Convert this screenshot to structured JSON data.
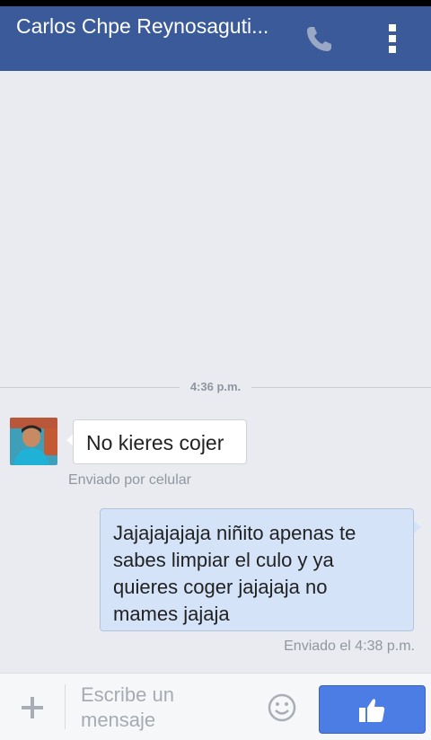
{
  "header": {
    "title": "Carlos Chpe Reynosaguti...",
    "call_icon": "phone-icon",
    "menu_icon": "overflow-menu-icon"
  },
  "conversation": {
    "time_separator": "4:36 p.m.",
    "messages": [
      {
        "direction": "incoming",
        "text": "No kieres cojer",
        "meta": "Enviado por celular",
        "avatar": "contact-avatar"
      },
      {
        "direction": "outgoing",
        "lines": [
          "Jajajajajaja niñito apenas te",
          "sabes limpiar el culo y ya",
          "quieres coger jajajaja no",
          "mames jajaja"
        ],
        "meta": "Enviado el 4:38 p.m."
      }
    ]
  },
  "composer": {
    "placeholder_lines": [
      "Escribe un",
      "mensaje"
    ],
    "attach_icon": "plus-icon",
    "emoji_icon": "smiley-icon",
    "send_icon": "thumbs-up-icon"
  },
  "colors": {
    "header": "#3b5a9a",
    "background": "#e9ebf0",
    "outgoing_bubble": "#d4e3f8",
    "like_button": "#4c7de4"
  }
}
